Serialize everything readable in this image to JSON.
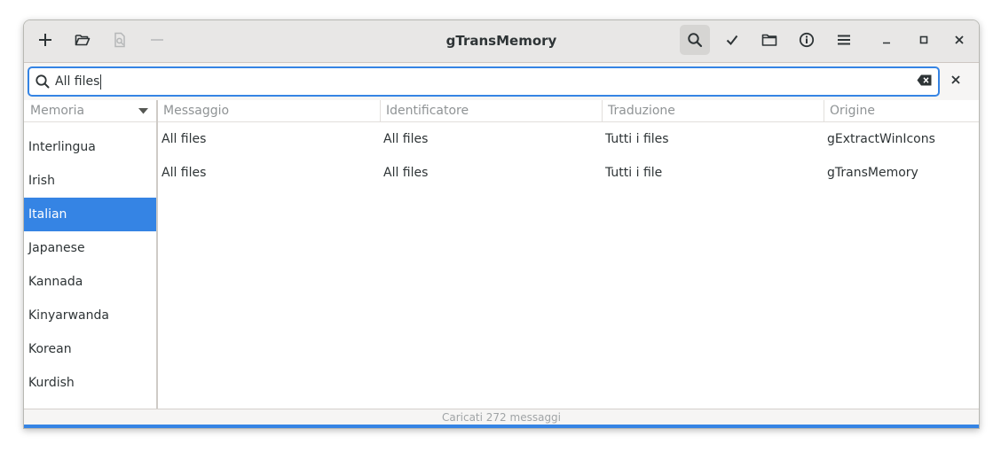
{
  "app": {
    "title": "gTransMemory"
  },
  "toolbar": {
    "left_icons": [
      "add-icon",
      "open-folder-icon",
      "document-search-icon",
      "remove-icon"
    ],
    "right_icons": [
      "search-icon",
      "checkmark-icon",
      "folder-icon",
      "info-icon",
      "menu-icon"
    ],
    "window_controls": [
      "minimize-icon",
      "maximize-icon",
      "close-icon"
    ]
  },
  "search": {
    "value": "All files",
    "clear_icon": "clear-text-icon",
    "close_icon": "close-icon"
  },
  "sidebar": {
    "header": "Memoria",
    "items": [
      {
        "label": "Interlingua",
        "selected": false
      },
      {
        "label": "Irish",
        "selected": false
      },
      {
        "label": "Italian",
        "selected": true
      },
      {
        "label": "Japanese",
        "selected": false
      },
      {
        "label": "Kannada",
        "selected": false
      },
      {
        "label": "Kinyarwanda",
        "selected": false
      },
      {
        "label": "Korean",
        "selected": false
      },
      {
        "label": "Kurdish",
        "selected": false
      }
    ]
  },
  "table": {
    "columns": [
      "Messaggio",
      "Identificatore",
      "Traduzione",
      "Origine"
    ],
    "rows": [
      [
        "All files",
        "All files",
        "Tutti i files",
        "gExtractWinIcons"
      ],
      [
        "All files",
        "All files",
        "Tutti i file",
        "gTransMemory"
      ]
    ]
  },
  "status": {
    "text": "Caricati 272 messaggi"
  },
  "colors": {
    "accent": "#3584e4",
    "headerbar": "#e8e7e6"
  }
}
